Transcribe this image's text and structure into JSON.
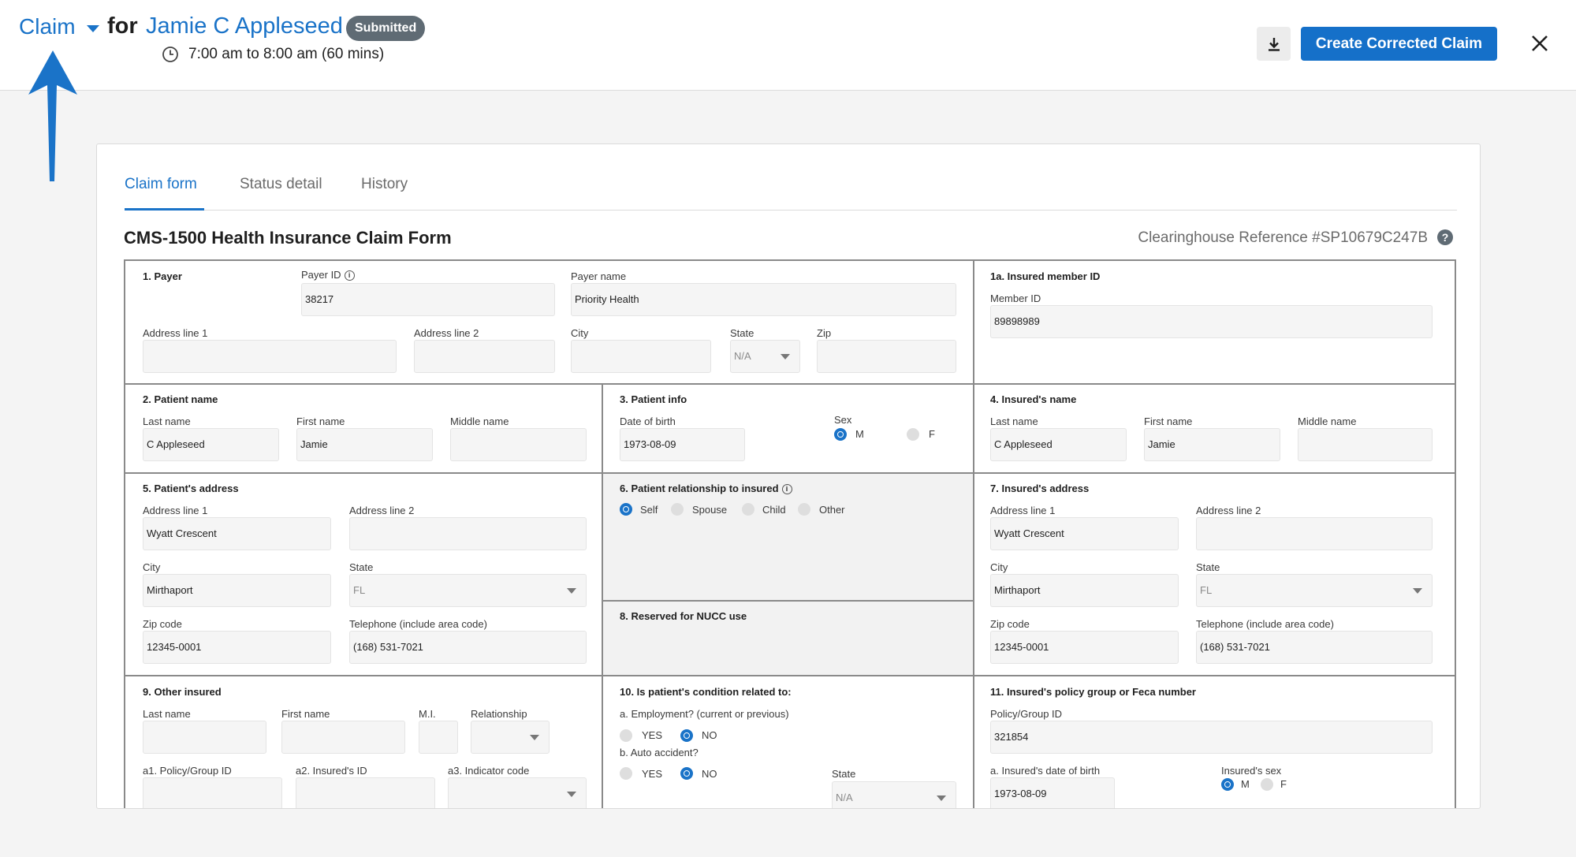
{
  "header": {
    "claim_menu_label": "Claim",
    "for_label": "for",
    "patient_name": "Jamie C Appleseed",
    "status_badge": "Submitted",
    "time_range": "7:00 am to 8:00 am (60 mins)",
    "primary_button": "Create Corrected Claim"
  },
  "tabs": [
    "Claim form",
    "Status detail",
    "History"
  ],
  "form_title": "CMS-1500 Health Insurance Claim Form",
  "clearinghouse_ref": "Clearinghouse Reference #SP10679C247B",
  "help_glyph": "?",
  "info_glyph": "i",
  "sections": {
    "payer": {
      "title": "1. Payer",
      "payer_id_label": "Payer ID",
      "payer_id": "38217",
      "payer_name_label": "Payer name",
      "payer_name": "Priority Health",
      "addr1_label": "Address line 1",
      "addr1": "",
      "addr2_label": "Address line 2",
      "addr2": "",
      "city_label": "City",
      "city": "",
      "state_label": "State",
      "state": "N/A",
      "zip_label": "Zip",
      "zip": ""
    },
    "insured_member": {
      "title": "1a. Insured member ID",
      "member_id_label": "Member ID",
      "member_id": "89898989"
    },
    "patient_name": {
      "title": "2. Patient name",
      "last_label": "Last name",
      "last": "C Appleseed",
      "first_label": "First name",
      "first": "Jamie",
      "middle_label": "Middle name",
      "middle": ""
    },
    "patient_info": {
      "title": "3. Patient info",
      "dob_label": "Date of birth",
      "dob": "1973-08-09",
      "sex_label": "Sex",
      "sex_m": "M",
      "sex_f": "F",
      "sex_selected": "M"
    },
    "insured_name": {
      "title": "4. Insured's name",
      "last_label": "Last name",
      "last": "C Appleseed",
      "first_label": "First name",
      "first": "Jamie",
      "middle_label": "Middle name",
      "middle": ""
    },
    "patient_address": {
      "title": "5. Patient's address",
      "addr1_label": "Address line 1",
      "addr1": "Wyatt Crescent",
      "addr2_label": "Address line 2",
      "addr2": "",
      "city_label": "City",
      "city": "Mirthaport",
      "state_label": "State",
      "state": "FL",
      "zip_label": "Zip code",
      "zip": "12345-0001",
      "phone_label": "Telephone (include area code)",
      "phone": "(168) 531-7021"
    },
    "relationship": {
      "title": "6. Patient relationship to insured",
      "options": [
        "Self",
        "Spouse",
        "Child",
        "Other"
      ],
      "selected": "Self"
    },
    "insured_address": {
      "title": "7. Insured's address",
      "addr1_label": "Address line 1",
      "addr1": "Wyatt Crescent",
      "addr2_label": "Address line 2",
      "addr2": "",
      "city_label": "City",
      "city": "Mirthaport",
      "state_label": "State",
      "state": "FL",
      "zip_label": "Zip code",
      "zip": "12345-0001",
      "phone_label": "Telephone (include area code)",
      "phone": "(168) 531-7021"
    },
    "reserved": {
      "title": "8. Reserved for NUCC use"
    },
    "other_insured": {
      "title": "9. Other insured",
      "last_label": "Last name",
      "first_label": "First name",
      "mi_label": "M.I.",
      "relationship_label": "Relationship",
      "a1_label": "a1. Policy/Group ID",
      "a2_label": "a2. Insured's ID",
      "a3_label": "a3. Indicator code"
    },
    "condition": {
      "title": "10. Is patient's condition related to:",
      "employment_label": "a. Employment? (current or previous)",
      "auto_label": "b. Auto accident?",
      "yes": "YES",
      "no": "NO",
      "employment_selected": "NO",
      "auto_selected": "NO",
      "state_label": "State",
      "state": "N/A"
    },
    "policy_group": {
      "title": "11. Insured's policy group or Feca number",
      "policy_label": "Policy/Group ID",
      "policy": "321854",
      "dob_label": "a. Insured's date of birth",
      "dob": "1973-08-09",
      "sex_label": "Insured's sex",
      "sex_m": "M",
      "sex_f": "F",
      "sex_selected": "M"
    }
  },
  "colors": {
    "accent": "#1a73c8",
    "primary_button": "#1570c9",
    "badge": "#5f6b74",
    "border": "#8a8a8a"
  },
  "icons": [
    "chevron-down-icon",
    "clock-icon",
    "download-icon",
    "close-icon",
    "help-icon",
    "info-icon",
    "arrow-up-icon"
  ]
}
